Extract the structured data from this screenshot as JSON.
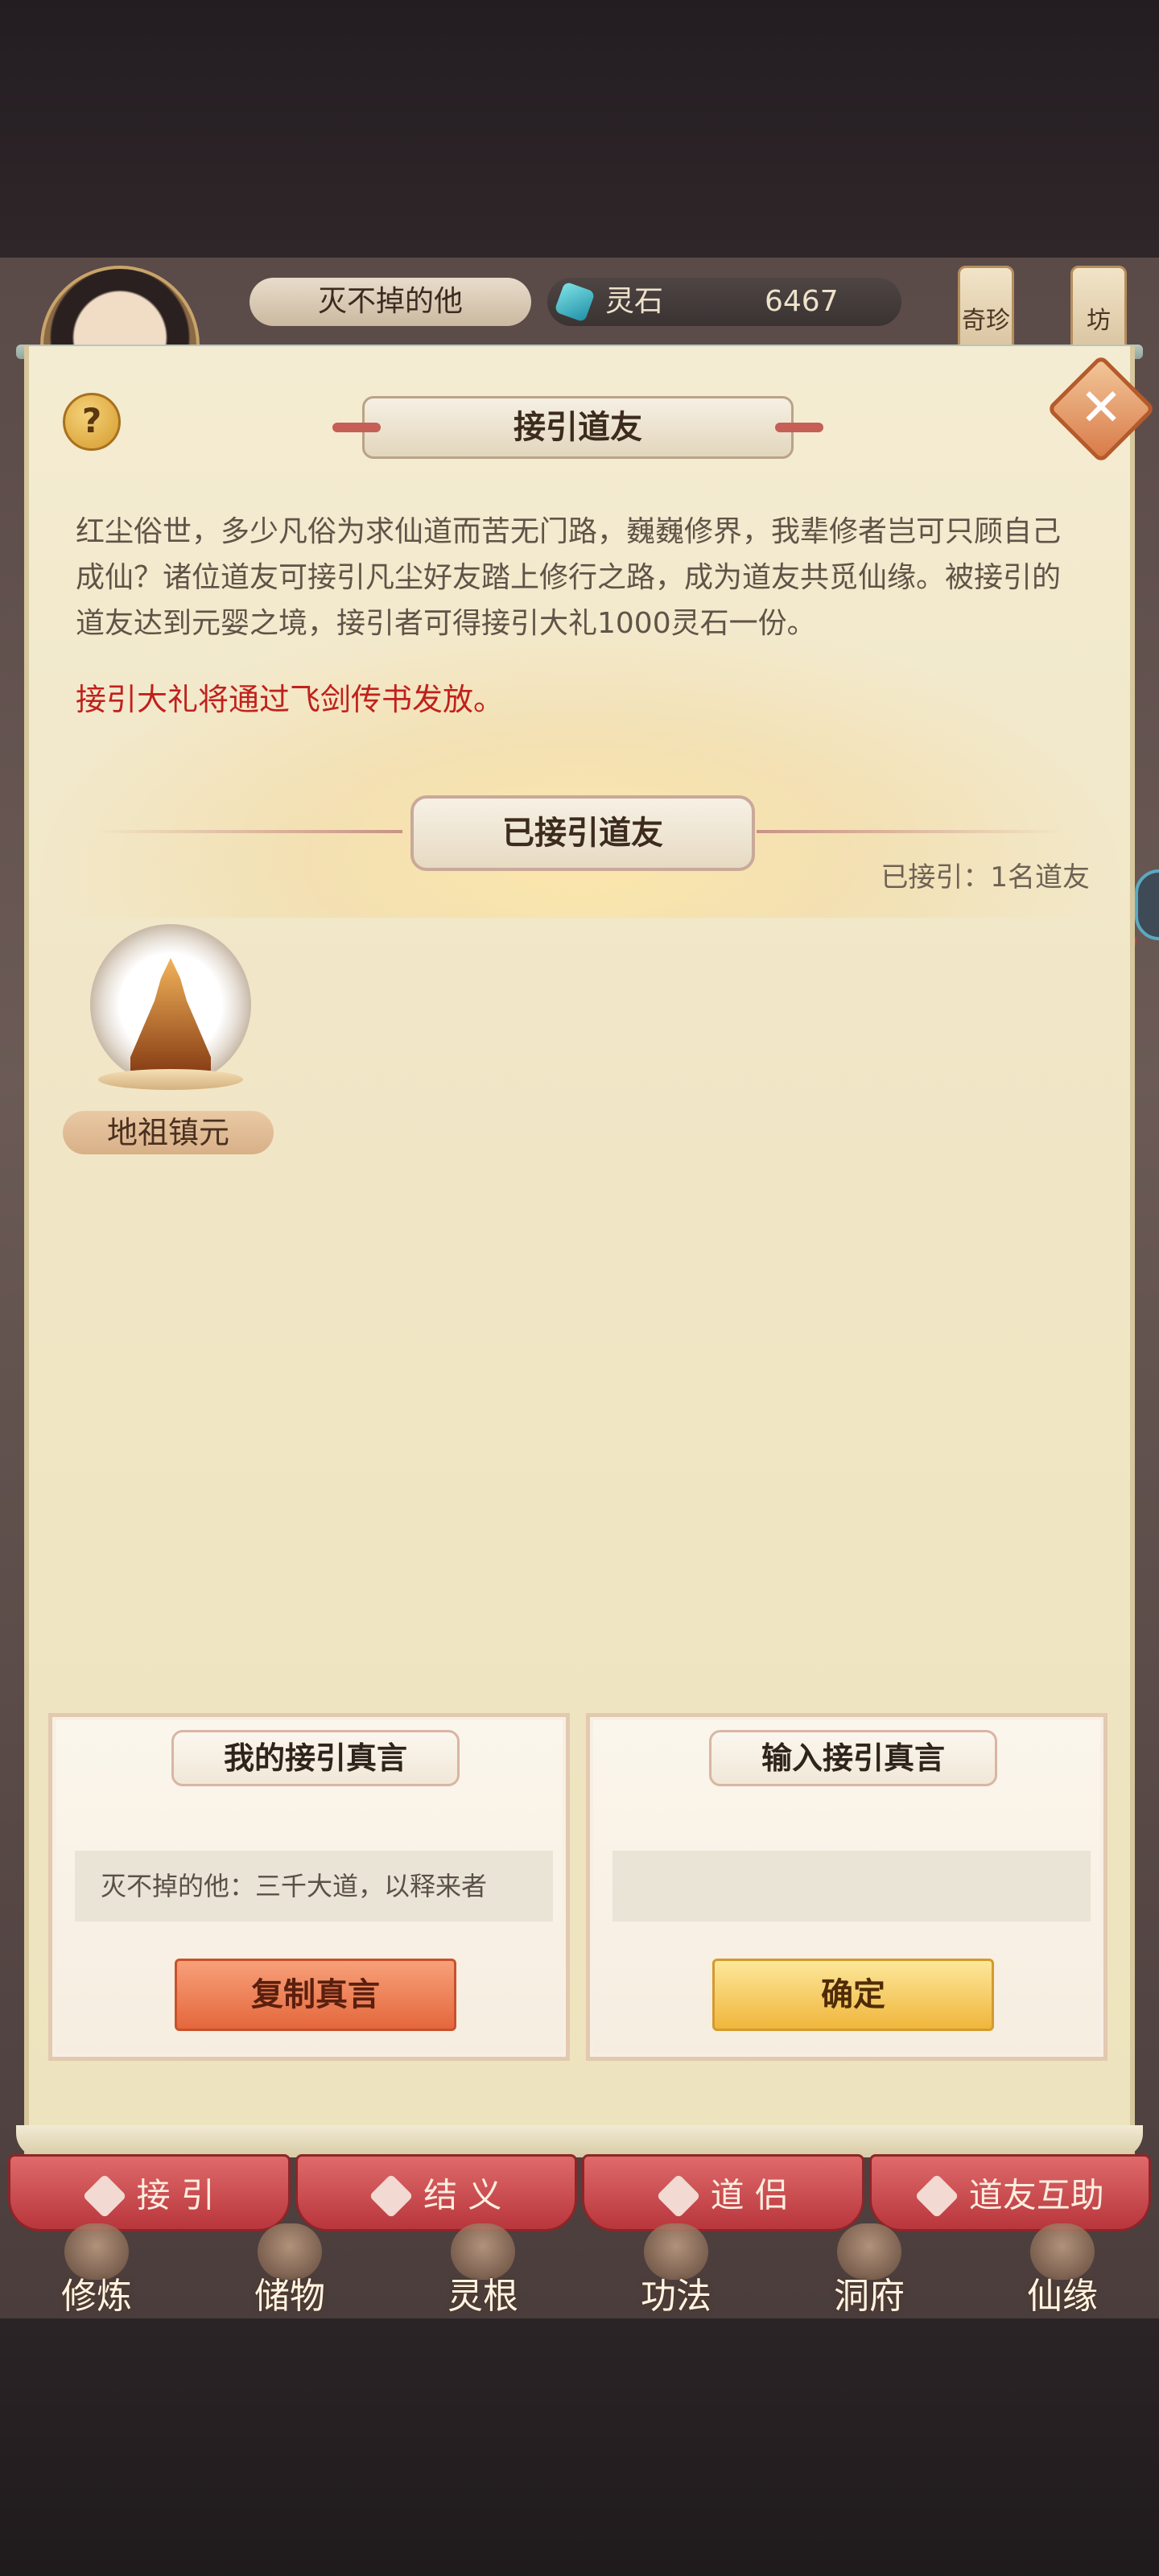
{
  "hud": {
    "player_name": "灭不掉的他",
    "currency_label": "灵石",
    "currency_value": "6467",
    "tag_left": "奇珍",
    "tag_right": "坊"
  },
  "modal": {
    "title": "接引道友",
    "help_label": "?",
    "close_label": "✕",
    "description": "红尘俗世，多少凡俗为求仙道而苦无门路，巍巍修界，我辈修者岂可只顾自己成仙？诸位道友可接引凡尘好友踏上修行之路，成为道友共觅仙缘。被接引的道友达到元婴之境，接引者可得接引大礼1000灵石一份。",
    "notice": "接引大礼将通过飞剑传书发放。",
    "section_title": "已接引道友",
    "count_text": "已接引：1名道友",
    "friends": [
      {
        "name": "地祖镇元"
      }
    ],
    "my_code_card": {
      "title": "我的接引真言",
      "code_text": "灭不掉的他：三千大道，以释来者",
      "button_label": "复制真言"
    },
    "input_code_card": {
      "title": "输入接引真言",
      "input_value": "",
      "input_placeholder": "",
      "button_label": "确定"
    }
  },
  "tabs": [
    {
      "label": "接 引",
      "icon": "person-icon"
    },
    {
      "label": "结 义",
      "icon": "handshake-icon"
    },
    {
      "label": "道 侣",
      "icon": "footprint-icon"
    },
    {
      "label": "道友互助",
      "icon": "gift-icon"
    }
  ],
  "menu": [
    {
      "label": "修炼"
    },
    {
      "label": "储物"
    },
    {
      "label": "灵根"
    },
    {
      "label": "功法"
    },
    {
      "label": "洞府"
    },
    {
      "label": "仙缘"
    }
  ]
}
